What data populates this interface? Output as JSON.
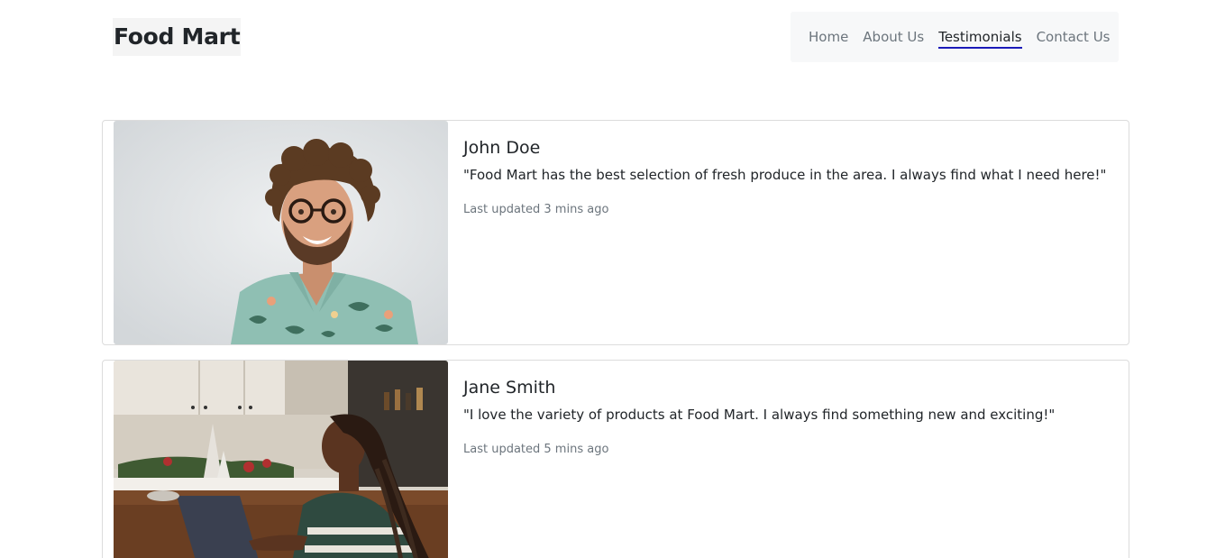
{
  "header": {
    "brand": "Food Mart",
    "nav": [
      {
        "label": "Home"
      },
      {
        "label": "About Us"
      },
      {
        "label": "Testimonials",
        "active": true
      },
      {
        "label": "Contact Us"
      }
    ]
  },
  "testimonials": [
    {
      "name": "John Doe",
      "quote": "\"Food Mart has the best selection of fresh produce in the area. I always find what I need here!\"",
      "updated": "Last updated 3 mins ago"
    },
    {
      "name": "Jane Smith",
      "quote": "\"I love the variety of products at Food Mart. I always find something new and exciting!\"",
      "updated": "Last updated 5 mins ago"
    }
  ],
  "colors": {
    "nav_active_underline": "#1a1ab8",
    "muted_text": "#6c757d",
    "nav_bg": "#f7f8f9"
  }
}
